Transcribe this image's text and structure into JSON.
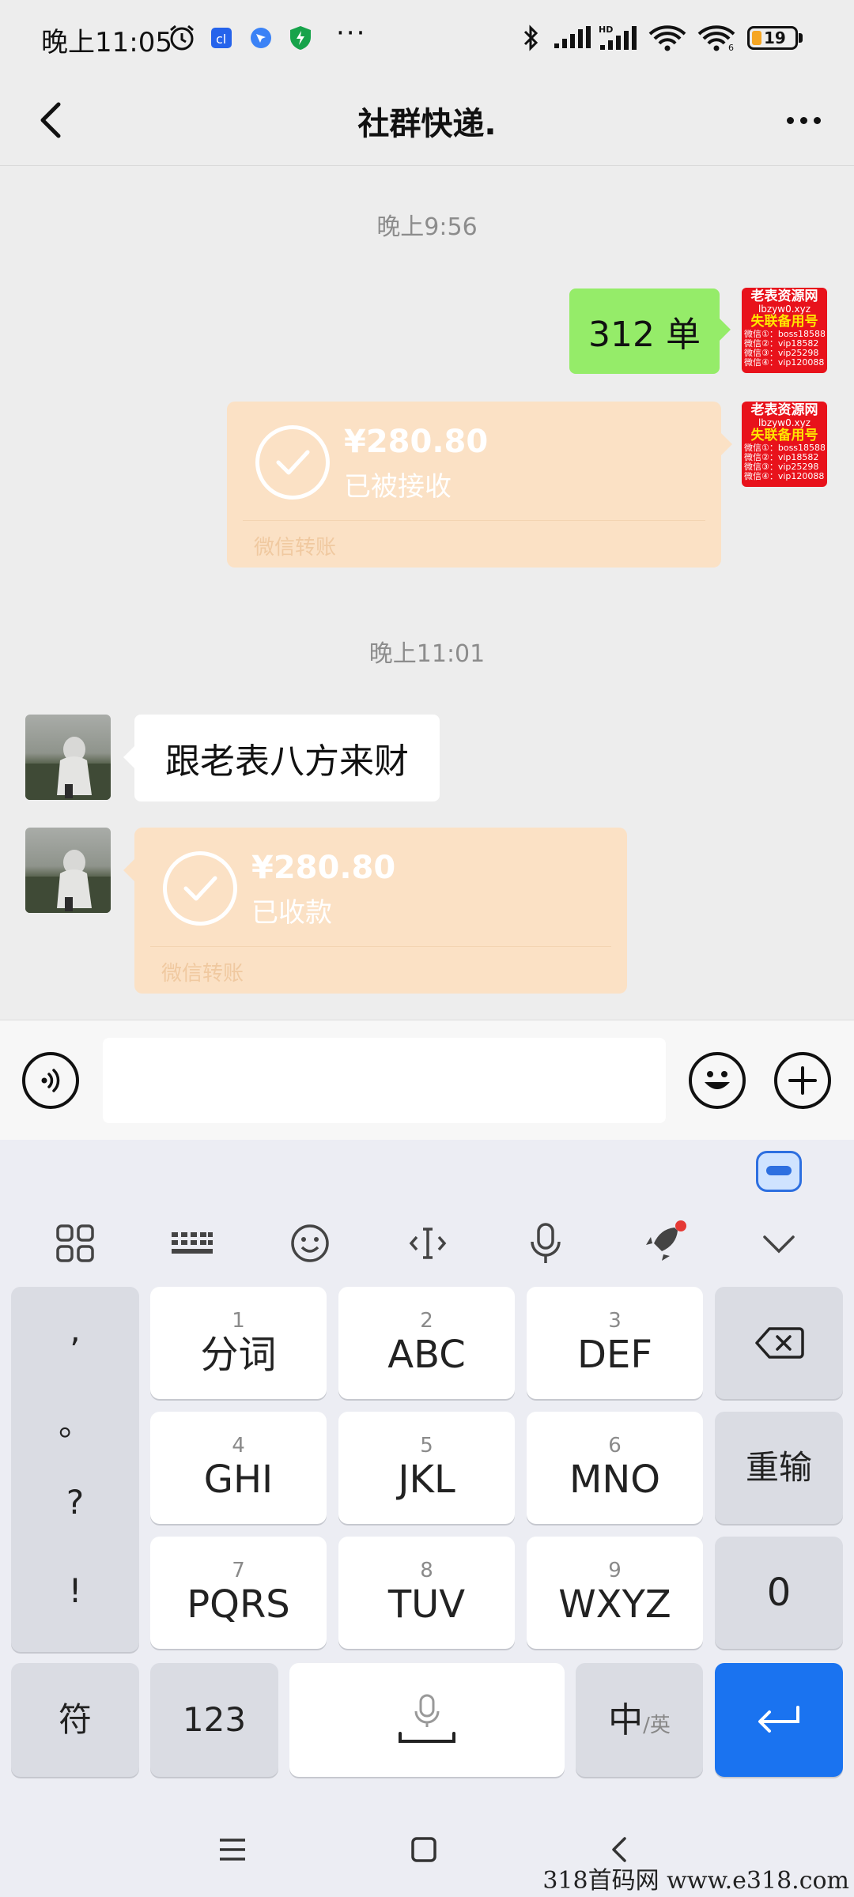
{
  "status_bar": {
    "time": "晚上11:05",
    "battery": "19"
  },
  "header": {
    "title": "社群快递."
  },
  "messages": {
    "time1": "晚上9:56",
    "sent_text": "312 单",
    "sent_transfer": {
      "amount": "¥280.80",
      "status": "已被接收",
      "footer": "微信转账"
    },
    "time2": "晚上11:01",
    "recv_text": "跟老表八方来财",
    "recv_transfer": {
      "amount": "¥280.80",
      "status": "已收款",
      "footer": "微信转账"
    }
  },
  "self_avatar": {
    "line1": "老表资源网",
    "line2": "lbzyw0.xyz",
    "line3": "失联备用号",
    "line4": "微信①：boss18588",
    "line5": "微信②：vip18582",
    "line6": "微信③：vip25298",
    "line7": "微信④：vip1200880"
  },
  "input": {
    "value": ""
  },
  "keyboard": {
    "punct": [
      ",",
      "。",
      "?",
      "!"
    ],
    "keys": [
      {
        "num": "1",
        "label": "分词"
      },
      {
        "num": "2",
        "label": "ABC"
      },
      {
        "num": "3",
        "label": "DEF"
      },
      {
        "num": "4",
        "label": "GHI"
      },
      {
        "num": "5",
        "label": "JKL"
      },
      {
        "num": "6",
        "label": "MNO"
      },
      {
        "num": "7",
        "label": "PQRS"
      },
      {
        "num": "8",
        "label": "TUV"
      },
      {
        "num": "9",
        "label": "WXYZ"
      }
    ],
    "retype": "重输",
    "zero": "0",
    "symbols": "符",
    "numbers": "123",
    "lang_main": "中",
    "lang_alt": "/英"
  },
  "watermark": "318首码网 www.e318.com",
  "colors": {
    "chat_bg": "#ededed",
    "sent_bubble": "#95ec69",
    "transfer_bubble": "#fbe1c5",
    "enter_key": "#1a73f0",
    "avatar_red": "#e8121b"
  }
}
